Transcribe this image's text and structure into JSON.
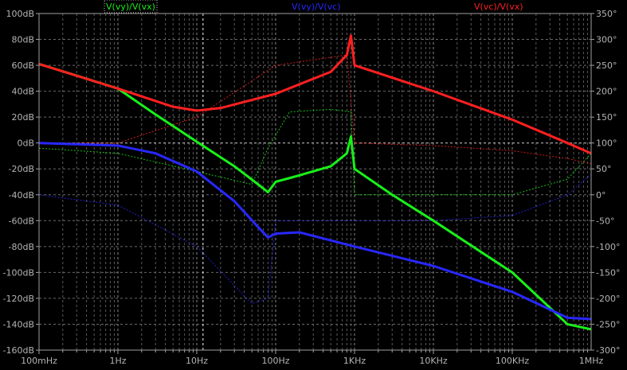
{
  "chart_data": {
    "type": "line",
    "x_scale": "log",
    "x_range_hz": [
      0.1,
      1000000
    ],
    "x_ticks": [
      {
        "value": 0.1,
        "label": "100mHz"
      },
      {
        "value": 1,
        "label": "1Hz"
      },
      {
        "value": 10,
        "label": "10Hz"
      },
      {
        "value": 100,
        "label": "100Hz"
      },
      {
        "value": 1000,
        "label": "1KHz"
      },
      {
        "value": 10000,
        "label": "10KHz"
      },
      {
        "value": 100000,
        "label": "100KHz"
      },
      {
        "value": 1000000,
        "label": "1MHz"
      }
    ],
    "y_left_range_db": [
      -160,
      100
    ],
    "y_left_ticks": [
      {
        "value": 100,
        "label": "100dB"
      },
      {
        "value": 80,
        "label": "80dB"
      },
      {
        "value": 60,
        "label": "60dB"
      },
      {
        "value": 40,
        "label": "40dB"
      },
      {
        "value": 20,
        "label": "20dB"
      },
      {
        "value": 0,
        "label": "0dB"
      },
      {
        "value": -20,
        "label": "-20dB"
      },
      {
        "value": -40,
        "label": "-40dB"
      },
      {
        "value": -60,
        "label": "-60dB"
      },
      {
        "value": -80,
        "label": "-80dB"
      },
      {
        "value": -100,
        "label": "-100dB"
      },
      {
        "value": -120,
        "label": "-120dB"
      },
      {
        "value": -140,
        "label": "-140dB"
      },
      {
        "value": -160,
        "label": "-160dB"
      }
    ],
    "y_right_range_deg": [
      -300,
      350
    ],
    "y_right_ticks": [
      {
        "value": 350,
        "label": "350°"
      },
      {
        "value": 300,
        "label": "300°"
      },
      {
        "value": 250,
        "label": "250°"
      },
      {
        "value": 200,
        "label": "200°"
      },
      {
        "value": 150,
        "label": "150°"
      },
      {
        "value": 100,
        "label": "100°"
      },
      {
        "value": 50,
        "label": "50°"
      },
      {
        "value": 0,
        "label": "0°"
      },
      {
        "value": -50,
        "label": "-50°"
      },
      {
        "value": -100,
        "label": "-100°"
      },
      {
        "value": -150,
        "label": "-150°"
      },
      {
        "value": -200,
        "label": "-200°"
      },
      {
        "value": -250,
        "label": "-250°"
      },
      {
        "value": -300,
        "label": "-300°"
      }
    ],
    "grid": true,
    "cursor_x_hz": 12,
    "series": [
      {
        "name": "V(vy)/V(vx)",
        "color": "#19f019",
        "magnitude_db": [
          [
            0.1,
            61
          ],
          [
            0.3,
            52
          ],
          [
            1,
            42
          ],
          [
            3,
            22
          ],
          [
            10,
            1
          ],
          [
            30,
            -18
          ],
          [
            60,
            -32
          ],
          [
            80,
            -38
          ],
          [
            100,
            -30
          ],
          [
            200,
            -25
          ],
          [
            500,
            -18
          ],
          [
            800,
            -8
          ],
          [
            900,
            5
          ],
          [
            1000,
            -20
          ],
          [
            3000,
            -40
          ],
          [
            10000,
            -60
          ],
          [
            100000,
            -100
          ],
          [
            500000,
            -140
          ],
          [
            1000000,
            -144
          ]
        ],
        "phase_deg": [
          [
            0.1,
            90
          ],
          [
            1,
            80
          ],
          [
            10,
            45
          ],
          [
            50,
            20
          ],
          [
            80,
            90
          ],
          [
            150,
            160
          ],
          [
            500,
            165
          ],
          [
            900,
            160
          ],
          [
            1000,
            0
          ],
          [
            10000,
            0
          ],
          [
            100000,
            0
          ],
          [
            500000,
            30
          ],
          [
            1000000,
            80
          ]
        ]
      },
      {
        "name": "V(vy)/V(vc)",
        "color": "#2828ff",
        "magnitude_db": [
          [
            0.1,
            0
          ],
          [
            1,
            -2
          ],
          [
            3,
            -8
          ],
          [
            10,
            -22
          ],
          [
            30,
            -45
          ],
          [
            60,
            -65
          ],
          [
            80,
            -73
          ],
          [
            100,
            -70
          ],
          [
            200,
            -69
          ],
          [
            1000,
            -80
          ],
          [
            10000,
            -95
          ],
          [
            100000,
            -115
          ],
          [
            500000,
            -135
          ],
          [
            1000000,
            -136
          ]
        ],
        "phase_deg": [
          [
            0.1,
            0
          ],
          [
            1,
            -20
          ],
          [
            10,
            -100
          ],
          [
            50,
            -210
          ],
          [
            80,
            -200
          ],
          [
            100,
            -50
          ],
          [
            200,
            -50
          ],
          [
            1000,
            -50
          ],
          [
            10000,
            -50
          ],
          [
            100000,
            -40
          ],
          [
            500000,
            0
          ],
          [
            1000000,
            40
          ]
        ]
      },
      {
        "name": "V(vc)/V(vx)",
        "color": "#ff2020",
        "magnitude_db": [
          [
            0.1,
            61
          ],
          [
            1,
            42
          ],
          [
            5,
            28
          ],
          [
            10,
            25
          ],
          [
            20,
            27
          ],
          [
            100,
            38
          ],
          [
            500,
            55
          ],
          [
            800,
            68
          ],
          [
            900,
            83
          ],
          [
            1000,
            60
          ],
          [
            10000,
            40
          ],
          [
            100000,
            18
          ],
          [
            500000,
            0
          ],
          [
            1000000,
            -8
          ]
        ],
        "phase_deg": [
          [
            0.1,
            100
          ],
          [
            1,
            100
          ],
          [
            10,
            150
          ],
          [
            100,
            250
          ],
          [
            800,
            270
          ],
          [
            1000,
            100
          ],
          [
            10000,
            95
          ],
          [
            100000,
            85
          ],
          [
            500000,
            70
          ],
          [
            1000000,
            60
          ]
        ]
      }
    ]
  }
}
